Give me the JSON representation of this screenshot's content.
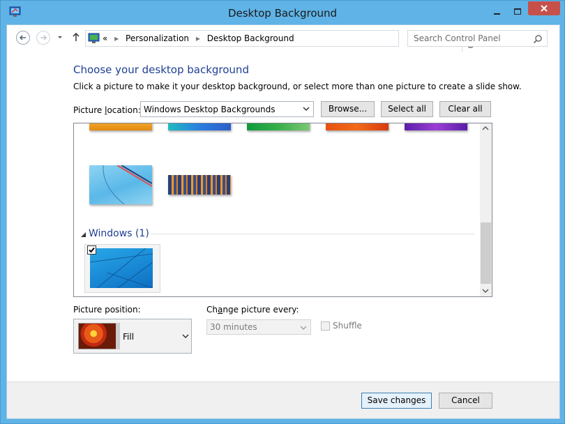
{
  "window": {
    "title": "Desktop Background"
  },
  "address": {
    "overflow": "«",
    "crumbs": [
      "Personalization",
      "Desktop Background"
    ]
  },
  "search": {
    "placeholder": "Search Control Panel"
  },
  "main": {
    "heading": "Choose your desktop background",
    "instructions": "Click a picture to make it your desktop background, or select more than one picture to create a slide show.",
    "picture_location_label": "Picture location:",
    "picture_location_value": "Windows Desktop Backgrounds",
    "buttons": {
      "browse": "Browse...",
      "select_all": "Select all",
      "clear_all": "Clear all"
    }
  },
  "gallery": {
    "group_label": "Windows (1)",
    "windows_thumb_checked": true
  },
  "position": {
    "label": "Picture position:",
    "value": "Fill"
  },
  "change": {
    "label": "Change picture every:",
    "value": "30 minutes"
  },
  "shuffle": {
    "label": "Shuffle",
    "checked": false
  },
  "footer": {
    "save_label": "Save changes",
    "cancel_label": "Cancel"
  },
  "colors": {
    "accent": "#5fb3e6",
    "heading": "#1e3f93",
    "close": "#c7504a"
  }
}
